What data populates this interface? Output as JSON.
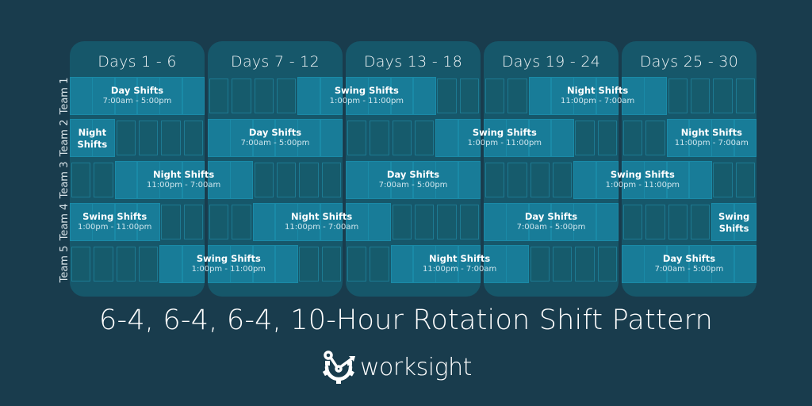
{
  "colors": {
    "background": "#193c4d",
    "column": "#16576a",
    "work_day": "#187c98",
    "off_day": "#165b6c",
    "text": "#ffffff"
  },
  "columns": [
    {
      "label": "Days 1 - 6"
    },
    {
      "label": "Days 7 - 12"
    },
    {
      "label": "Days 13 - 18"
    },
    {
      "label": "Days 19 - 24"
    },
    {
      "label": "Days 25 - 30"
    }
  ],
  "teams": [
    {
      "label": "Team 1",
      "days": [
        1,
        1,
        1,
        1,
        1,
        1,
        0,
        0,
        0,
        0,
        1,
        1,
        1,
        1,
        1,
        1,
        0,
        0,
        0,
        0,
        1,
        1,
        1,
        1,
        1,
        1,
        0,
        0,
        0,
        0
      ],
      "blocks": [
        {
          "name": "Day Shifts",
          "time": "7:00am - 5:00pm",
          "start": 1,
          "end": 6
        },
        {
          "name": "Swing Shifts",
          "time": "1:00pm - 11:00pm",
          "start": 11,
          "end": 16
        },
        {
          "name": "Night Shifts",
          "time": "11:00pm - 7:00am",
          "start": 21,
          "end": 26
        }
      ]
    },
    {
      "label": "Team 2",
      "days": [
        1,
        1,
        0,
        0,
        0,
        0,
        1,
        1,
        1,
        1,
        1,
        1,
        0,
        0,
        0,
        0,
        1,
        1,
        1,
        1,
        1,
        1,
        0,
        0,
        0,
        0,
        1,
        1,
        1,
        1
      ],
      "blocks": [
        {
          "name": "Night Shifts",
          "time": "",
          "start": 1,
          "end": 2,
          "wrap": true
        },
        {
          "name": "Day Shifts",
          "time": "7:00am - 5:00pm",
          "start": 7,
          "end": 12
        },
        {
          "name": "Swing Shifts",
          "time": "1:00pm - 11:00pm",
          "start": 17,
          "end": 22
        },
        {
          "name": "Night Shifts",
          "time": "11:00pm - 7:00am",
          "start": 27,
          "end": 30
        }
      ]
    },
    {
      "label": "Team 3",
      "days": [
        0,
        0,
        1,
        1,
        1,
        1,
        1,
        1,
        0,
        0,
        0,
        0,
        1,
        1,
        1,
        1,
        1,
        1,
        0,
        0,
        0,
        0,
        1,
        1,
        1,
        1,
        1,
        1,
        0,
        0
      ],
      "blocks": [
        {
          "name": "Night Shifts",
          "time": "11:00pm - 7:00am",
          "start": 3,
          "end": 8
        },
        {
          "name": "Day Shifts",
          "time": "7:00am - 5:00pm",
          "start": 13,
          "end": 18
        },
        {
          "name": "Swing Shifts",
          "time": "1:00pm - 11:00pm",
          "start": 23,
          "end": 28
        }
      ]
    },
    {
      "label": "Team 4",
      "days": [
        1,
        1,
        1,
        1,
        0,
        0,
        0,
        0,
        1,
        1,
        1,
        1,
        1,
        1,
        0,
        0,
        0,
        0,
        1,
        1,
        1,
        1,
        1,
        1,
        0,
        0,
        0,
        0,
        1,
        1
      ],
      "blocks": [
        {
          "name": "Swing Shifts",
          "time": "1:00pm - 11:00pm",
          "start": 1,
          "end": 4
        },
        {
          "name": "Night Shifts",
          "time": "11:00pm - 7:00am",
          "start": 9,
          "end": 14
        },
        {
          "name": "Day Shifts",
          "time": "7:00am - 5:00pm",
          "start": 19,
          "end": 24
        },
        {
          "name": "Swing Shifts",
          "time": "",
          "start": 29,
          "end": 30,
          "wrap": true
        }
      ]
    },
    {
      "label": "Team 5",
      "days": [
        0,
        0,
        0,
        0,
        1,
        1,
        1,
        1,
        1,
        1,
        0,
        0,
        0,
        0,
        1,
        1,
        1,
        1,
        1,
        1,
        0,
        0,
        0,
        0,
        1,
        1,
        1,
        1,
        1,
        1
      ],
      "blocks": [
        {
          "name": "Swing Shifts",
          "time": "1:00pm - 11:00pm",
          "start": 5,
          "end": 10
        },
        {
          "name": "Night Shifts",
          "time": "11:00pm - 7:00am",
          "start": 15,
          "end": 20
        },
        {
          "name": "Day Shifts",
          "time": "7:00am - 5:00pm",
          "start": 25,
          "end": 30
        }
      ]
    }
  ],
  "title": "6-4, 6-4, 6-4, 10-Hour Rotation Shift Pattern",
  "logo": {
    "text": "worksight",
    "icon": "gear-wrench-arrow-icon"
  }
}
